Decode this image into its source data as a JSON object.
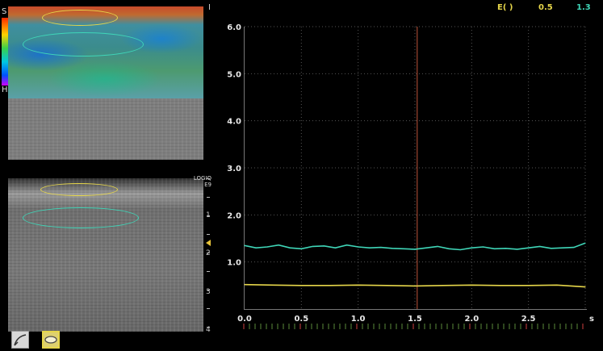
{
  "header": {
    "elasticity_label": "E( )",
    "value_yellow": "0.5",
    "value_cyan": "1.3",
    "color_yellow": "#e6d64a",
    "color_cyan": "#3fd6b8"
  },
  "scale": {
    "top_label": "S",
    "bottom_label": "H"
  },
  "bmode": {
    "logo_line1": "LOGIQ",
    "logo_line2": "E9",
    "depth_ticks": [
      "1",
      "2",
      "3",
      "4"
    ]
  },
  "toolbar": {
    "icon1": "curve-tool-icon",
    "icon2": "ellipse-roi-icon"
  },
  "cursor_marker": "I",
  "time_unit": "s",
  "chart_data": {
    "type": "line",
    "title": "",
    "xlabel": "s",
    "ylabel": "",
    "xlim": [
      0,
      3
    ],
    "ylim": [
      0,
      6
    ],
    "y_ticks": [
      "6.0",
      "5.0",
      "4.0",
      "3.0",
      "2.0",
      "1.0"
    ],
    "x_ticks": [
      "0.0",
      "0.5",
      "1.0",
      "1.5",
      "2.0",
      "2.5",
      "s"
    ],
    "cursor_x": 1.52,
    "grid": true,
    "series": [
      {
        "color": "#3fd6b8",
        "x": [
          0.0,
          0.1,
          0.2,
          0.3,
          0.4,
          0.5,
          0.6,
          0.7,
          0.8,
          0.9,
          1.0,
          1.1,
          1.2,
          1.3,
          1.4,
          1.5,
          1.6,
          1.7,
          1.8,
          1.9,
          2.0,
          2.1,
          2.2,
          2.3,
          2.4,
          2.5,
          2.6,
          2.7,
          2.8,
          2.9,
          3.0
        ],
        "values": [
          1.35,
          1.3,
          1.32,
          1.36,
          1.3,
          1.28,
          1.33,
          1.34,
          1.3,
          1.36,
          1.32,
          1.3,
          1.31,
          1.29,
          1.28,
          1.27,
          1.3,
          1.33,
          1.28,
          1.26,
          1.3,
          1.32,
          1.28,
          1.29,
          1.27,
          1.3,
          1.33,
          1.29,
          1.3,
          1.31,
          1.4
        ]
      },
      {
        "color": "#e6d64a",
        "x": [
          0.0,
          0.25,
          0.5,
          0.75,
          1.0,
          1.25,
          1.5,
          1.75,
          2.0,
          2.25,
          2.5,
          2.75,
          3.0
        ],
        "values": [
          0.52,
          0.51,
          0.5,
          0.5,
          0.51,
          0.5,
          0.49,
          0.5,
          0.51,
          0.5,
          0.5,
          0.51,
          0.47
        ]
      }
    ]
  }
}
